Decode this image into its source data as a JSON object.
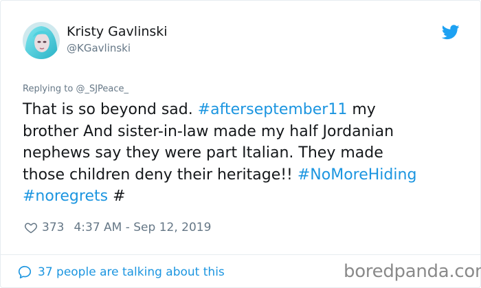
{
  "tweet": {
    "display_name": "Kristy Gavlinski",
    "handle": "@KGavlinski",
    "reply_prefix": "Replying to",
    "reply_to": "@_SJPeace_",
    "text_lines": [
      [
        {
          "t": "That is so beyond sad.  ",
          "k": "plain"
        },
        {
          "t": "#afterseptember11",
          "k": "tag"
        },
        {
          "t": "  my",
          "k": "plain"
        }
      ],
      [
        {
          "t": "brother And sister-in-law made my half Jordanian",
          "k": "plain"
        }
      ],
      [
        {
          "t": "nephews say they were part Italian. They made",
          "k": "plain"
        }
      ],
      [
        {
          "t": "those children deny their heritage!! ",
          "k": "plain"
        },
        {
          "t": "#NoMoreHiding",
          "k": "tag"
        }
      ],
      [
        {
          "t": "#noregrets",
          "k": "tag"
        },
        {
          "t": " #",
          "k": "plain"
        }
      ]
    ],
    "likes": "373",
    "timestamp": "4:37 AM - Sep 12, 2019",
    "talking": "37 people are talking about this"
  },
  "icons": {
    "brand": "twitter-bird-icon",
    "like": "heart-icon",
    "talk": "speech-bubble-icon"
  },
  "watermark": "boredpanda.com",
  "colors": {
    "link": "#1b95e0",
    "text": "#14171a",
    "secondary": "#657786",
    "divider": "#e6ecf0",
    "watermark": "#8a8a8a"
  }
}
